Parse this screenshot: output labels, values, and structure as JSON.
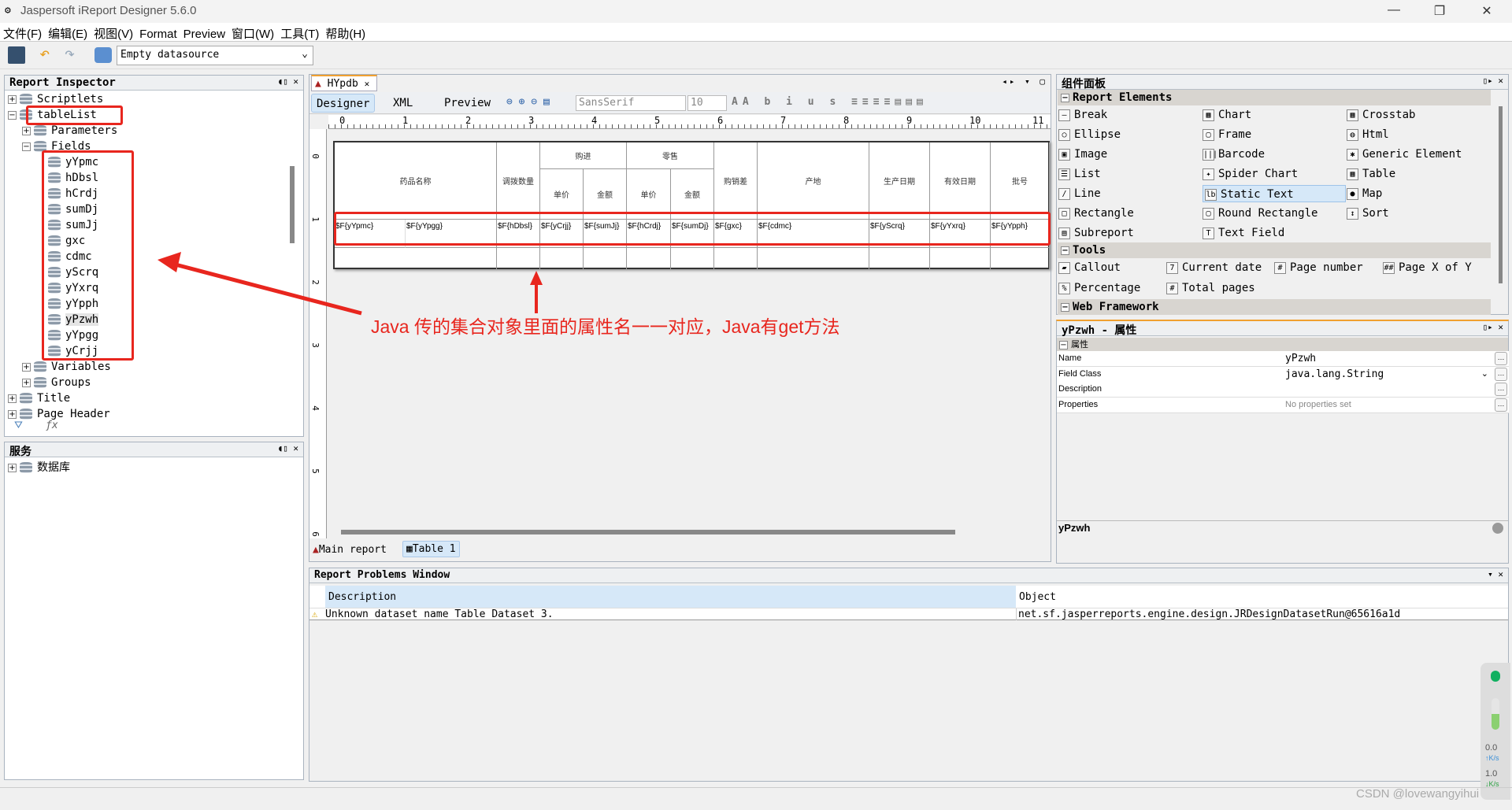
{
  "window": {
    "title": "Jaspersoft iReport Designer 5.6.0",
    "controls": [
      "—",
      "❐",
      "✕"
    ]
  },
  "menu": [
    "文件(F)",
    "编辑(E)",
    "视图(V)",
    "Format",
    "Preview",
    "窗口(W)",
    "工具(T)",
    "帮助(H)"
  ],
  "toolbar": {
    "datasource": "Empty datasource"
  },
  "inspector": {
    "title": "Report Inspector",
    "items": [
      {
        "label": "Scriptlets",
        "level": 0,
        "expander": "+"
      },
      {
        "label": "tableList",
        "level": 0,
        "expander": "−"
      },
      {
        "label": "Parameters",
        "level": 1,
        "expander": "+"
      },
      {
        "label": "Fields",
        "level": 1,
        "expander": "−"
      },
      {
        "label": "yYpmc",
        "level": 2
      },
      {
        "label": "hDbsl",
        "level": 2
      },
      {
        "label": "hCrdj",
        "level": 2
      },
      {
        "label": "sumDj",
        "level": 2
      },
      {
        "label": "sumJj",
        "level": 2
      },
      {
        "label": "gxc",
        "level": 2
      },
      {
        "label": "cdmc",
        "level": 2
      },
      {
        "label": "yScrq",
        "level": 2
      },
      {
        "label": "yYxrq",
        "level": 2
      },
      {
        "label": "yYpph",
        "level": 2
      },
      {
        "label": "yPzwh",
        "level": 2,
        "selected": true
      },
      {
        "label": "yYpgg",
        "level": 2
      },
      {
        "label": "yCrjj",
        "level": 2
      },
      {
        "label": "Variables",
        "level": 1,
        "expander": "+"
      },
      {
        "label": "Groups",
        "level": 1,
        "expander": "+"
      },
      {
        "label": "Title",
        "level": 0,
        "expander": "+"
      },
      {
        "label": "Page Header",
        "level": 0,
        "expander": "+"
      }
    ]
  },
  "services": {
    "title": "服务",
    "items": [
      {
        "label": "数据库"
      }
    ]
  },
  "editor": {
    "tab": "HYpdb",
    "modes": [
      "Designer",
      "XML",
      "Preview"
    ],
    "font": "SansSerif",
    "size": "10",
    "ruler": [
      "0",
      "1",
      "2",
      "3",
      "4",
      "5",
      "6",
      "7",
      "8",
      "9",
      "10",
      "11"
    ],
    "vruler": [
      "0",
      "1",
      "2",
      "3",
      "4",
      "5",
      "6"
    ],
    "headers": {
      "top": [
        "药品名称",
        "调拨数量",
        "购进",
        "零售",
        "购销差",
        "产地",
        "生产日期",
        "有效日期",
        "批号"
      ],
      "sub": [
        "单价",
        "金额",
        "单价",
        "金额"
      ]
    },
    "fields": [
      "$F{yYpmc}",
      "$F{yYpgg}",
      "$F{hDbsl}",
      "$F{yCrjj}",
      "$F{sumJj}",
      "$F{hCrdj}",
      "$F{sumDj}",
      "$F{gxc}",
      "$F{cdmc}",
      "$F{yScrq}",
      "$F{yYxrq}",
      "$F{yYpph}"
    ],
    "bottom_tabs": [
      "Main report",
      "Table 1"
    ]
  },
  "annotation": "Java 传的集合对象里面的属性名一一对应，Java有get方法",
  "palette": {
    "title": "组件面板",
    "sections": [
      {
        "name": "Report Elements",
        "items": [
          "Break",
          "Chart",
          "Crosstab",
          "Ellipse",
          "Frame",
          "Html",
          "Image",
          "Barcode",
          "Generic Element",
          "List",
          "Spider Chart",
          "Table",
          "Line",
          "Static Text",
          "Map",
          "Rectangle",
          "Round Rectangle",
          "Sort",
          "Subreport",
          "Text Field"
        ]
      },
      {
        "name": "Tools",
        "items": [
          "Callout",
          "Current date",
          "Page number",
          "Page X of Y",
          "Percentage",
          "Total pages"
        ]
      },
      {
        "name": "Web Framework",
        "items": []
      }
    ],
    "selected": "Static Text"
  },
  "properties": {
    "title": "yPzwh - 属性",
    "section": "属性",
    "rows": [
      {
        "key": "Name",
        "value": "yPzwh"
      },
      {
        "key": "Field Class",
        "value": "java.lang.String"
      },
      {
        "key": "Description",
        "value": ""
      },
      {
        "key": "Properties",
        "value": "No properties set"
      }
    ],
    "footer": "yPzwh"
  },
  "problems": {
    "title": "Report Problems Window",
    "columns": [
      "Description",
      "Object"
    ],
    "rows": [
      {
        "description": "Unknown dataset name Table Dataset 3.",
        "object": "net.sf.jasperreports.engine.design.JRDesignDatasetRun@65616a1d",
        "severity": "warning"
      }
    ]
  },
  "network": {
    "up": "0.0",
    "up_unit": "K/s",
    "down": "1.0",
    "down_unit": "K/s"
  },
  "watermark": "CSDN @lovewangyihui",
  "colors": {
    "annotation": "#e8261e",
    "selected": "#d6e8f8"
  }
}
